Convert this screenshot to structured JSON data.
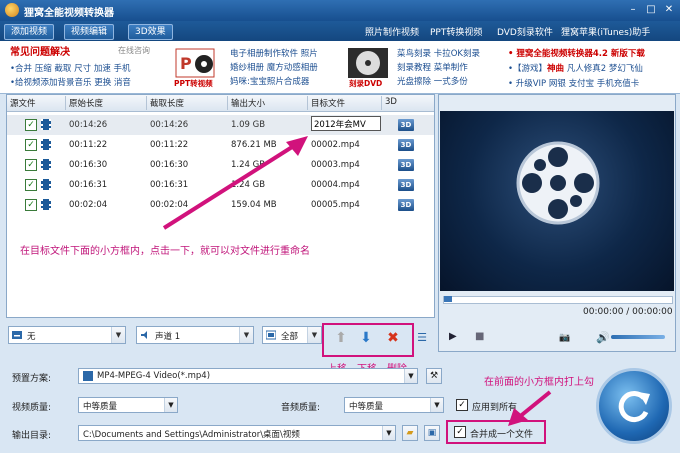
{
  "window": {
    "title": "狸窝全能视频转换器"
  },
  "menubar": {
    "left_buttons": [
      "添加视频",
      "视频编辑",
      "3D效果"
    ],
    "right_links": [
      "照片制作视频",
      "PPT转换视频",
      "DVD刻录软件",
      "狸窝苹果(iTunes)助手"
    ]
  },
  "ads": {
    "faq_title": "常见问题解决",
    "online_label": "在线咨询",
    "faq_line1": "•合并 压缩 截取 尺寸 加速 手机",
    "faq_line2": "•给视频添加背景音乐 更换 消音",
    "ppt_caption": "PPT转视频",
    "photo_line1": "电子相册制作软件 照片",
    "photo_line2": "婚纱相册 魔方动感相册",
    "photo_line3": "妈咪:宝宝照片合成器",
    "dvd_caption": "刻录DVD",
    "dvd_line1": "菜鸟刻录 卡拉OK刻录",
    "dvd_line2": "刻录教程 菜单制作",
    "dvd_line3": "光盘擦除 一式多份",
    "promo_line1": "• 狸窝全能视频转换器4.2 新版下载",
    "promo_line2a": "•【游戏】",
    "promo_line2b": "神曲",
    "promo_line2c": "凡人修真2 梦幻飞仙",
    "promo_line3": "• 升级VIP 网银 支付宝 手机充值卡"
  },
  "table": {
    "headers": [
      "源文件",
      "原始长度",
      "截取长度",
      "输出大小",
      "目标文件",
      "3D"
    ],
    "rows": [
      {
        "orig": "00:14:26",
        "cut": "00:14:26",
        "size": "1.09 GB",
        "target": "2012年会MV",
        "badge": "3D"
      },
      {
        "orig": "00:11:22",
        "cut": "00:11:22",
        "size": "876.21 MB",
        "target": "00002.mp4",
        "badge": "3D"
      },
      {
        "orig": "00:16:30",
        "cut": "00:16:30",
        "size": "1.24 GB",
        "target": "00003.mp4",
        "badge": "3D"
      },
      {
        "orig": "00:16:31",
        "cut": "00:16:31",
        "size": "1.24 GB",
        "target": "00004.mp4",
        "badge": "3D"
      },
      {
        "orig": "00:02:04",
        "cut": "00:02:04",
        "size": "159.04 MB",
        "target": "00005.mp4",
        "badge": "3D"
      }
    ]
  },
  "annotations": {
    "rename_hint": "在目标文件下面的小方框内，点击一下，就可以对文件进行重命名",
    "move_up": "上移",
    "move_down": "下移",
    "delete": "删除",
    "merge_hint": "在前面的小方框内打上勾"
  },
  "controls": {
    "subtitle": "无",
    "audio_track": "声道 1",
    "range": "全部"
  },
  "player": {
    "time": "00:00:00 / 00:00:00",
    "volume_level": 0.8
  },
  "output": {
    "preset_label": "预置方案:",
    "preset_value": "MP4-MPEG-4 Video(*.mp4)",
    "video_quality_label": "视频质量:",
    "video_quality_value": "中等质量",
    "audio_quality_label": "音频质量:",
    "audio_quality_value": "中等质量",
    "apply_all_label": "应用到所有",
    "dir_label": "输出目录:",
    "dir_value": "C:\\Documents and Settings\\Administrator\\桌面\\视频",
    "merge_label": "合并成一个文件"
  },
  "colors": {
    "accent": "#d1127c",
    "title_bar": "#1e5a99"
  }
}
